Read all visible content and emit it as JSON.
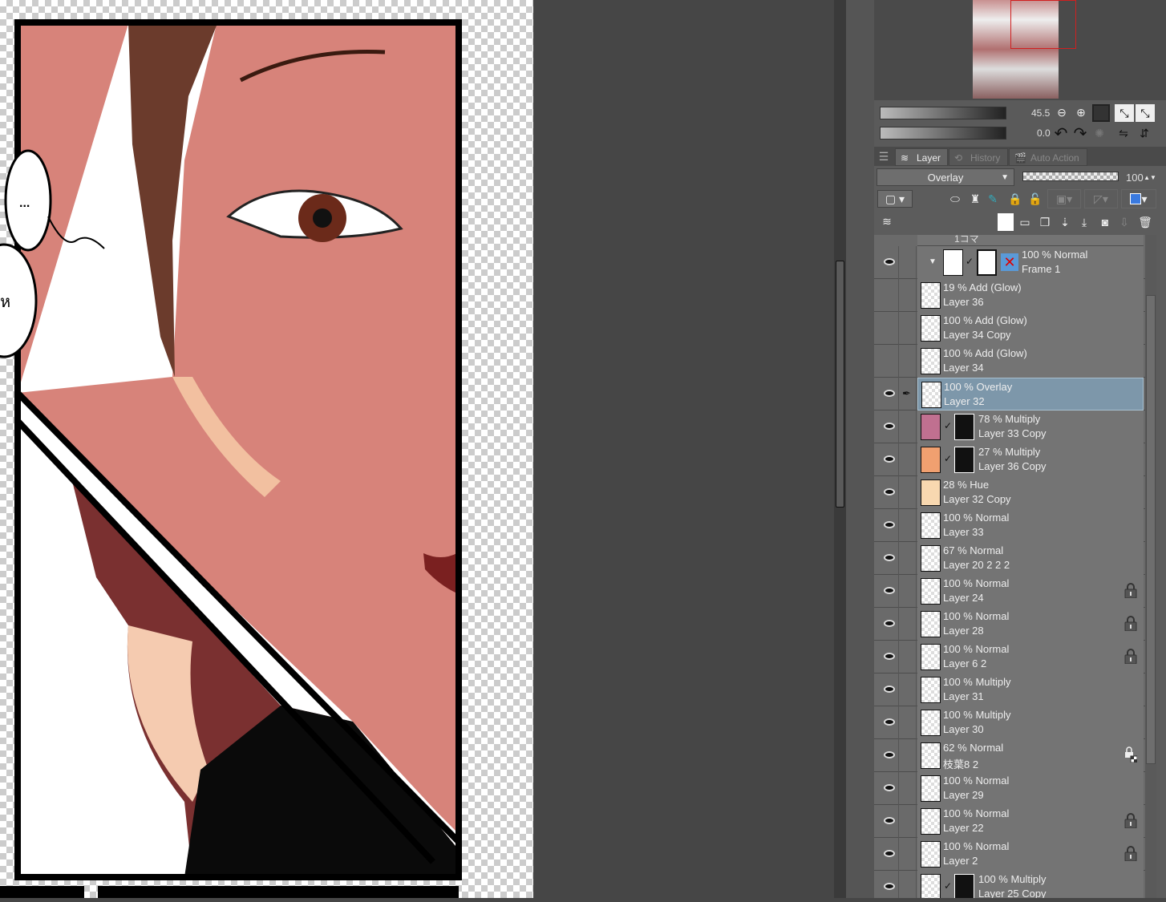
{
  "canvas": {
    "speech_bubble_text": "...",
    "speech_bubble_partial": "ห"
  },
  "navigator": {
    "zoom_value": "45.5",
    "rotate_value": "0.0"
  },
  "tabs": [
    {
      "label": "Layer"
    },
    {
      "label": "History"
    },
    {
      "label": "Auto Action"
    }
  ],
  "layer_properties": {
    "blend_mode": "Overlay",
    "opacity": "100"
  },
  "partial_row_label": "1コマ",
  "layers": [
    {
      "mode": "100 % Normal",
      "name": "Frame 1",
      "visible": true,
      "type": "frame"
    },
    {
      "mode": "19 % Add (Glow)",
      "name": "Layer 36",
      "visible": false
    },
    {
      "mode": "100 % Add (Glow)",
      "name": "Layer 34 Copy",
      "visible": false
    },
    {
      "mode": "100 % Add (Glow)",
      "name": "Layer 34",
      "visible": false
    },
    {
      "mode": "100 % Overlay",
      "name": "Layer 32",
      "visible": true,
      "selected": true
    },
    {
      "mode": "78 % Multiply",
      "name": "Layer 33 Copy",
      "visible": true,
      "mask": true,
      "thumb_color": "#c07090"
    },
    {
      "mode": "27 % Multiply",
      "name": "Layer 36 Copy",
      "visible": true,
      "mask": true,
      "thumb_color": "#f0a070"
    },
    {
      "mode": "28 % Hue",
      "name": "Layer 32 Copy",
      "visible": true,
      "thumb_color": "#f8d8b0"
    },
    {
      "mode": "100 % Normal",
      "name": "Layer 33",
      "visible": true
    },
    {
      "mode": "67 % Normal",
      "name": "Layer 20 2 2 2",
      "visible": true
    },
    {
      "mode": "100 % Normal",
      "name": "Layer 24",
      "visible": true,
      "lock": true
    },
    {
      "mode": "100 % Normal",
      "name": "Layer 28",
      "visible": true,
      "lock": true
    },
    {
      "mode": "100 % Normal",
      "name": "Layer 6 2",
      "visible": true,
      "lock": true
    },
    {
      "mode": "100 % Multiply",
      "name": "Layer 31",
      "visible": true
    },
    {
      "mode": "100 % Multiply",
      "name": "Layer 30",
      "visible": true
    },
    {
      "mode": "62 % Normal",
      "name": "枝葉8 2",
      "visible": true,
      "alpha_lock": true
    },
    {
      "mode": "100 % Normal",
      "name": "Layer 29",
      "visible": true
    },
    {
      "mode": "100 % Normal",
      "name": "Layer 22",
      "visible": true,
      "lock": true
    },
    {
      "mode": "100 % Normal",
      "name": "Layer 2",
      "visible": true,
      "lock": true
    },
    {
      "mode": "100 % Multiply",
      "name": "Layer 25 Copy",
      "visible": true,
      "mask": true
    }
  ]
}
